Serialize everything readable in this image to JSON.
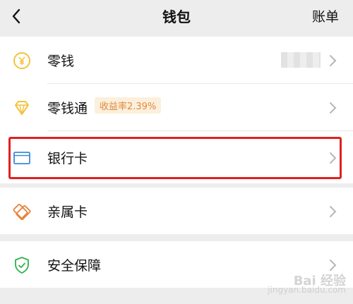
{
  "header": {
    "title": "钱包",
    "bill_label": "账单"
  },
  "rows": [
    {
      "label": "零钱",
      "icon": "coin-yen-icon"
    },
    {
      "label": "零钱通",
      "icon": "diamond-icon",
      "badge": "收益率2.39%"
    },
    {
      "label": "银行卡",
      "icon": "bank-card-icon",
      "highlighted": true
    },
    {
      "label": "亲属卡",
      "icon": "family-card-icon"
    },
    {
      "label": "安全保障",
      "icon": "shield-check-icon"
    }
  ],
  "watermark": {
    "main": "Bai 经验",
    "sub": "jingyan.baidu.com"
  },
  "colors": {
    "accent_yellow": "#f2c33b",
    "accent_orange": "#e8823a",
    "accent_blue": "#3a8bd8",
    "accent_green": "#2fb34a",
    "highlight_red": "#e02020"
  }
}
